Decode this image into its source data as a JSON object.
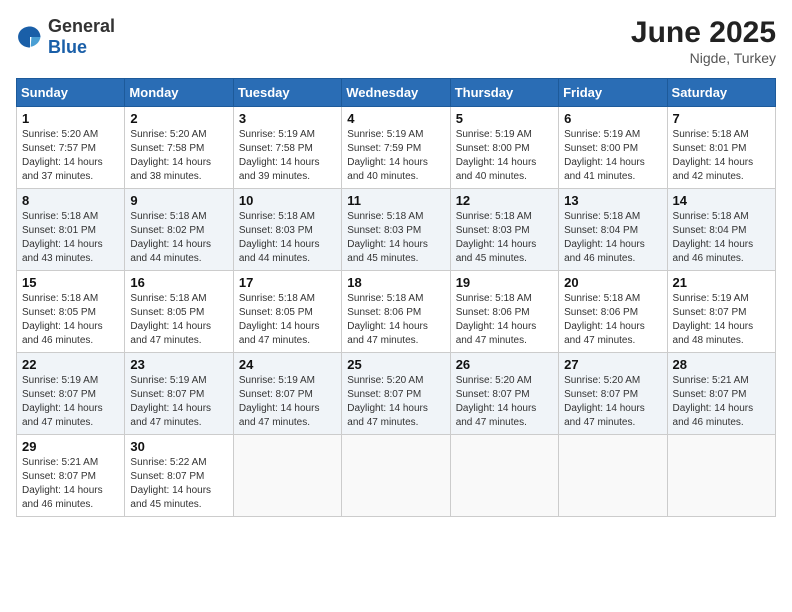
{
  "header": {
    "logo_general": "General",
    "logo_blue": "Blue",
    "month_year": "June 2025",
    "location": "Nigde, Turkey"
  },
  "weekdays": [
    "Sunday",
    "Monday",
    "Tuesday",
    "Wednesday",
    "Thursday",
    "Friday",
    "Saturday"
  ],
  "weeks": [
    [
      {
        "day": "1",
        "sunrise": "5:20 AM",
        "sunset": "7:57 PM",
        "daylight": "14 hours and 37 minutes."
      },
      {
        "day": "2",
        "sunrise": "5:20 AM",
        "sunset": "7:58 PM",
        "daylight": "14 hours and 38 minutes."
      },
      {
        "day": "3",
        "sunrise": "5:19 AM",
        "sunset": "7:58 PM",
        "daylight": "14 hours and 39 minutes."
      },
      {
        "day": "4",
        "sunrise": "5:19 AM",
        "sunset": "7:59 PM",
        "daylight": "14 hours and 40 minutes."
      },
      {
        "day": "5",
        "sunrise": "5:19 AM",
        "sunset": "8:00 PM",
        "daylight": "14 hours and 40 minutes."
      },
      {
        "day": "6",
        "sunrise": "5:19 AM",
        "sunset": "8:00 PM",
        "daylight": "14 hours and 41 minutes."
      },
      {
        "day": "7",
        "sunrise": "5:18 AM",
        "sunset": "8:01 PM",
        "daylight": "14 hours and 42 minutes."
      }
    ],
    [
      {
        "day": "8",
        "sunrise": "5:18 AM",
        "sunset": "8:01 PM",
        "daylight": "14 hours and 43 minutes."
      },
      {
        "day": "9",
        "sunrise": "5:18 AM",
        "sunset": "8:02 PM",
        "daylight": "14 hours and 44 minutes."
      },
      {
        "day": "10",
        "sunrise": "5:18 AM",
        "sunset": "8:03 PM",
        "daylight": "14 hours and 44 minutes."
      },
      {
        "day": "11",
        "sunrise": "5:18 AM",
        "sunset": "8:03 PM",
        "daylight": "14 hours and 45 minutes."
      },
      {
        "day": "12",
        "sunrise": "5:18 AM",
        "sunset": "8:03 PM",
        "daylight": "14 hours and 45 minutes."
      },
      {
        "day": "13",
        "sunrise": "5:18 AM",
        "sunset": "8:04 PM",
        "daylight": "14 hours and 46 minutes."
      },
      {
        "day": "14",
        "sunrise": "5:18 AM",
        "sunset": "8:04 PM",
        "daylight": "14 hours and 46 minutes."
      }
    ],
    [
      {
        "day": "15",
        "sunrise": "5:18 AM",
        "sunset": "8:05 PM",
        "daylight": "14 hours and 46 minutes."
      },
      {
        "day": "16",
        "sunrise": "5:18 AM",
        "sunset": "8:05 PM",
        "daylight": "14 hours and 47 minutes."
      },
      {
        "day": "17",
        "sunrise": "5:18 AM",
        "sunset": "8:05 PM",
        "daylight": "14 hours and 47 minutes."
      },
      {
        "day": "18",
        "sunrise": "5:18 AM",
        "sunset": "8:06 PM",
        "daylight": "14 hours and 47 minutes."
      },
      {
        "day": "19",
        "sunrise": "5:18 AM",
        "sunset": "8:06 PM",
        "daylight": "14 hours and 47 minutes."
      },
      {
        "day": "20",
        "sunrise": "5:18 AM",
        "sunset": "8:06 PM",
        "daylight": "14 hours and 47 minutes."
      },
      {
        "day": "21",
        "sunrise": "5:19 AM",
        "sunset": "8:07 PM",
        "daylight": "14 hours and 48 minutes."
      }
    ],
    [
      {
        "day": "22",
        "sunrise": "5:19 AM",
        "sunset": "8:07 PM",
        "daylight": "14 hours and 47 minutes."
      },
      {
        "day": "23",
        "sunrise": "5:19 AM",
        "sunset": "8:07 PM",
        "daylight": "14 hours and 47 minutes."
      },
      {
        "day": "24",
        "sunrise": "5:19 AM",
        "sunset": "8:07 PM",
        "daylight": "14 hours and 47 minutes."
      },
      {
        "day": "25",
        "sunrise": "5:20 AM",
        "sunset": "8:07 PM",
        "daylight": "14 hours and 47 minutes."
      },
      {
        "day": "26",
        "sunrise": "5:20 AM",
        "sunset": "8:07 PM",
        "daylight": "14 hours and 47 minutes."
      },
      {
        "day": "27",
        "sunrise": "5:20 AM",
        "sunset": "8:07 PM",
        "daylight": "14 hours and 47 minutes."
      },
      {
        "day": "28",
        "sunrise": "5:21 AM",
        "sunset": "8:07 PM",
        "daylight": "14 hours and 46 minutes."
      }
    ],
    [
      {
        "day": "29",
        "sunrise": "5:21 AM",
        "sunset": "8:07 PM",
        "daylight": "14 hours and 46 minutes."
      },
      {
        "day": "30",
        "sunrise": "5:22 AM",
        "sunset": "8:07 PM",
        "daylight": "14 hours and 45 minutes."
      },
      null,
      null,
      null,
      null,
      null
    ]
  ]
}
